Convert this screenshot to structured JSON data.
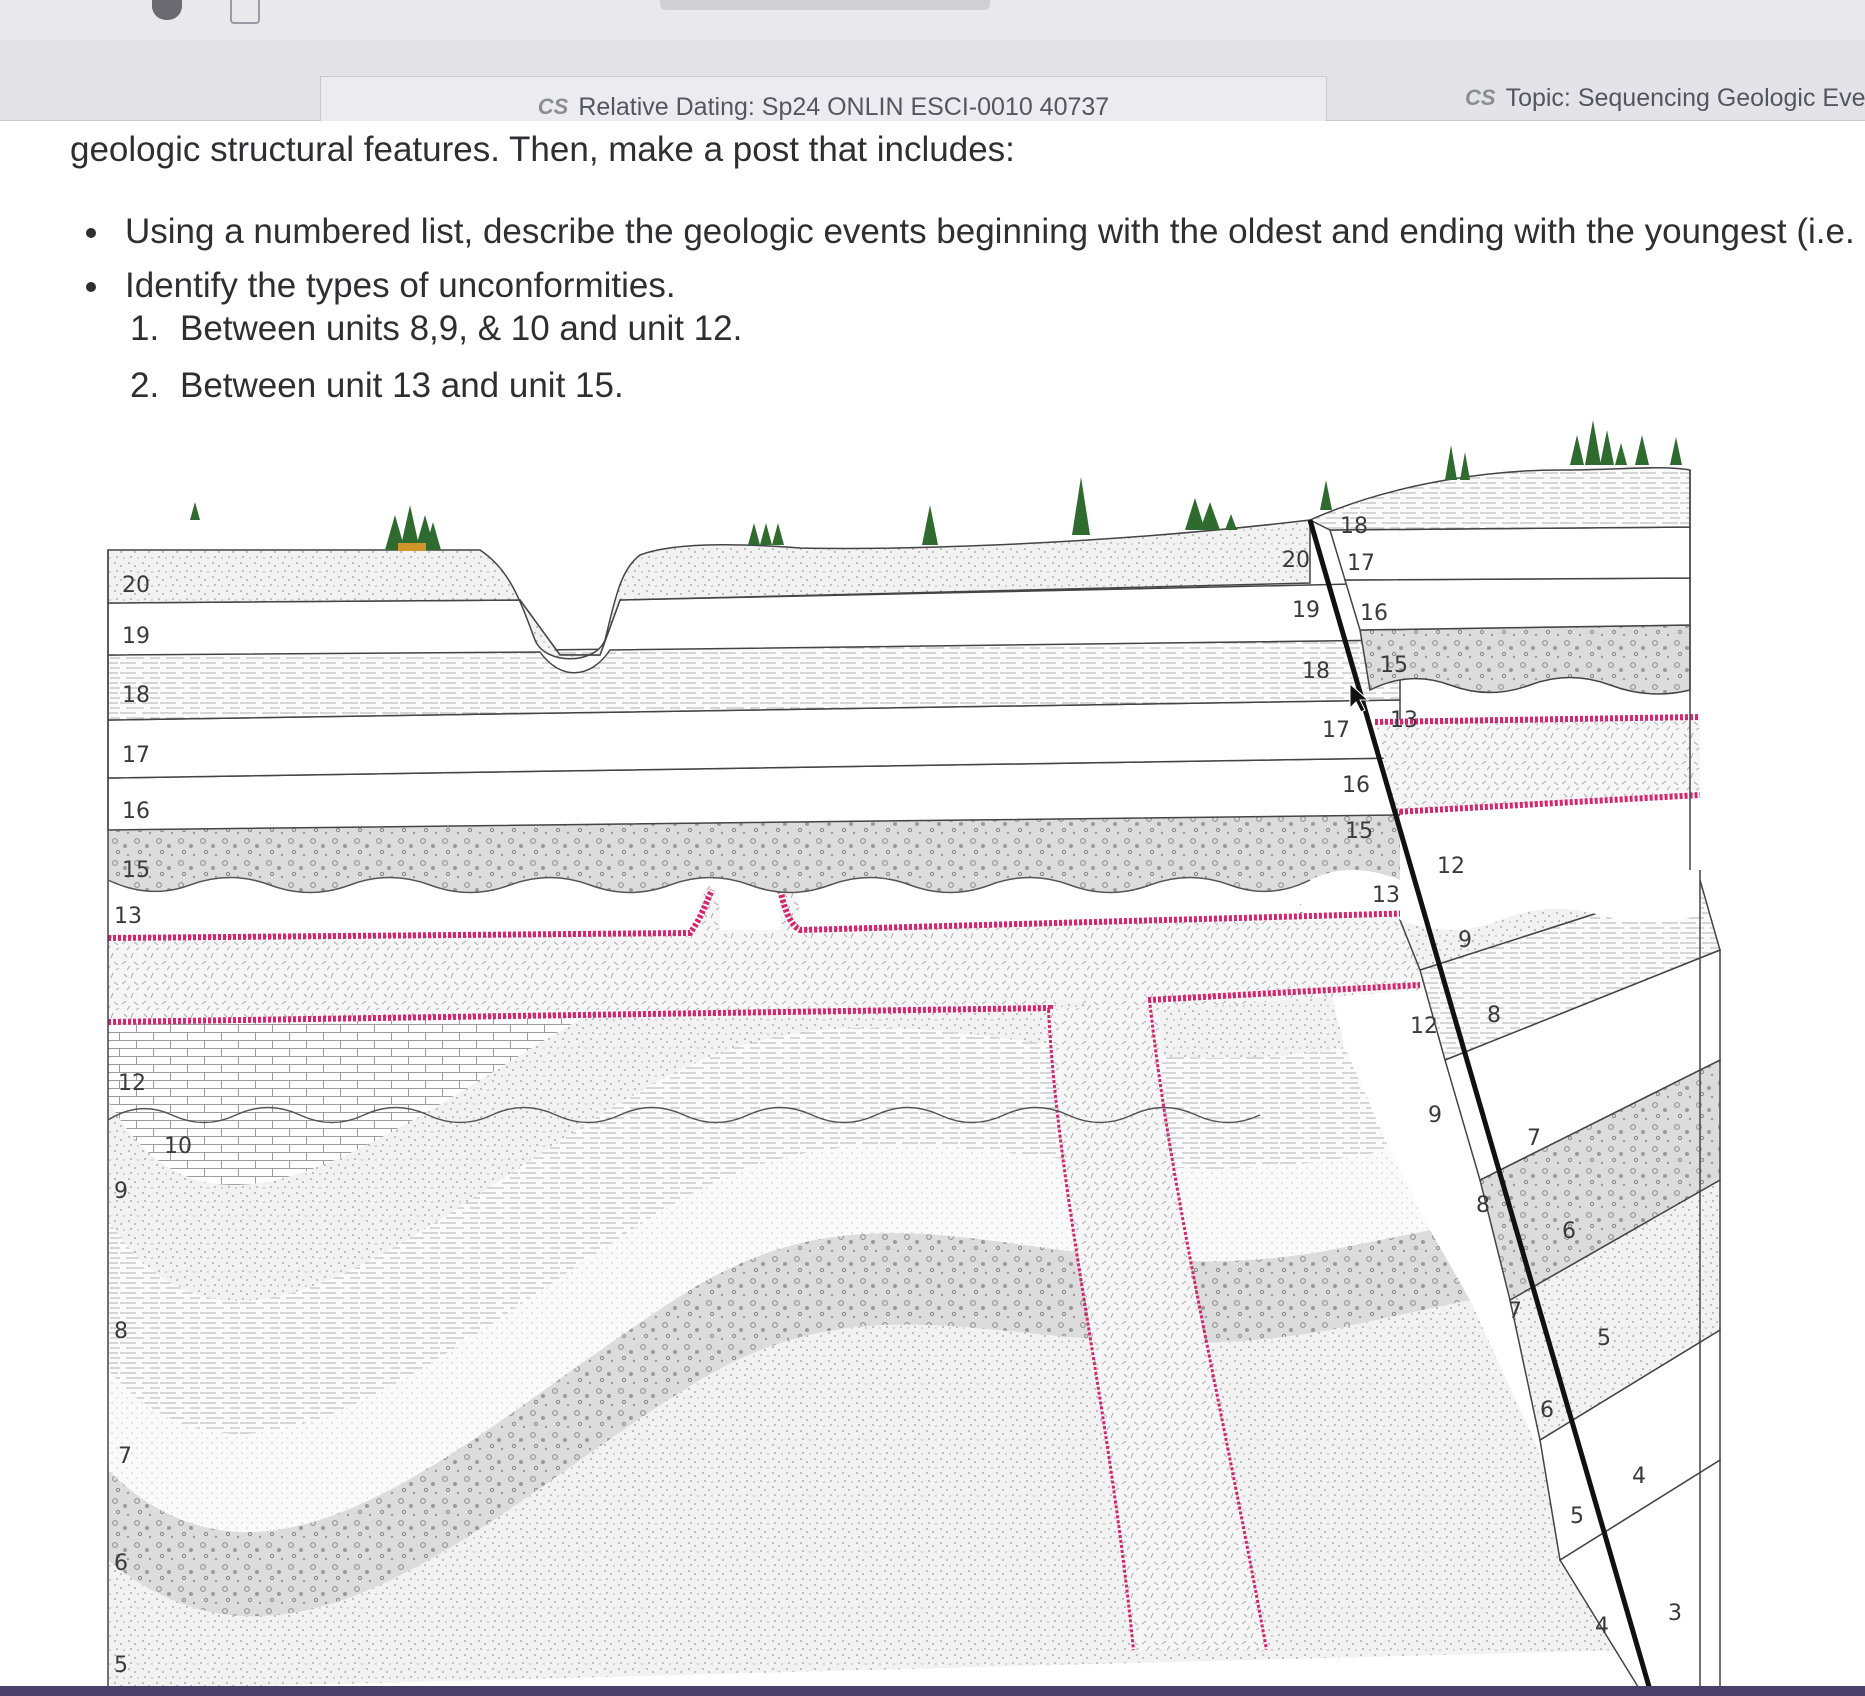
{
  "browser": {
    "tab_active": "Relative Dating: Sp24 ONLIN ESCI-0010 40737",
    "tab_other": "Topic: Sequencing Geologic Eve"
  },
  "assignment": {
    "intro": "geologic structural features.  Then, make a post that includes:",
    "bullets": [
      "Using a numbered list, describe the geologic events beginning with the oldest and ending with the youngest (i.e. m",
      "Identify the types of unconformities."
    ],
    "numbered": [
      {
        "num": "1.",
        "text": "Between units 8,9, & 10 and unit 12."
      },
      {
        "num": "2.",
        "text": "Between unit 13 and unit 15."
      }
    ]
  },
  "diagram": {
    "left_labels": [
      "20",
      "19",
      "18",
      "17",
      "16",
      "15",
      "13",
      "12",
      "10",
      "9",
      "8",
      "7",
      "6",
      "5"
    ],
    "fault_left_labels": [
      "20",
      "19",
      "18",
      "17",
      "16",
      "15",
      "13",
      "12",
      "9",
      "8",
      "7",
      "6",
      "5",
      "4"
    ],
    "fault_right_labels": [
      "18",
      "17",
      "16",
      "15",
      "13",
      "12",
      "9",
      "8",
      "7",
      "6",
      "5",
      "4",
      "3"
    ]
  },
  "colors": {
    "intrusion_edge": "#d6246e",
    "fault": "#111111",
    "tree": "#2f6b2f"
  }
}
